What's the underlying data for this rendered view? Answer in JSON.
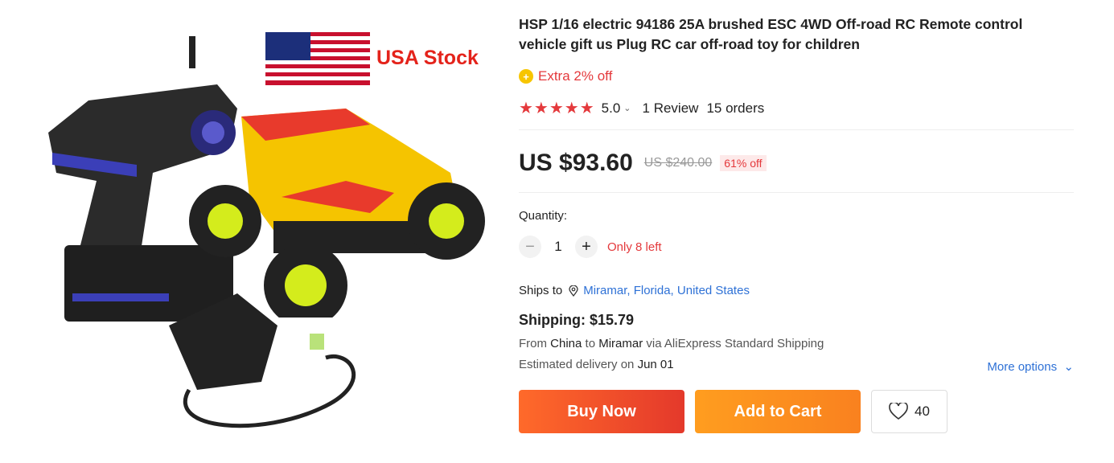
{
  "product": {
    "title": "HSP 1/16 electric 94186 25A brushed ESC 4WD Off-road RC Remote control vehicle gift us Plug RC car off-road toy for children",
    "badge_text": "USA Stock",
    "extra_off": "Extra 2% off",
    "rating_score": "5.0",
    "reviews": "1 Review",
    "orders": "15 orders",
    "price": "US $93.60",
    "original_price": "US $240.00",
    "discount": "61% off"
  },
  "quantity": {
    "label": "Quantity:",
    "value": "1",
    "stock_note": "Only 8 left"
  },
  "shipping": {
    "ships_to_label": "Ships to",
    "destination": "Miramar, Florida, United States",
    "cost": "Shipping: $15.79",
    "from_prefix": "From",
    "origin": "China",
    "to_word": "to",
    "dest_city": "Miramar",
    "via_text": "via AliExpress Standard Shipping",
    "est_prefix": "Estimated delivery on",
    "est_date": "Jun 01",
    "more_options": "More options"
  },
  "actions": {
    "buy_now": "Buy Now",
    "add_to_cart": "Add to Cart",
    "wishlist_count": "40"
  },
  "colors": {
    "accent": "#e4393c",
    "link": "#2e71d6",
    "cart": "#fa8c16"
  }
}
